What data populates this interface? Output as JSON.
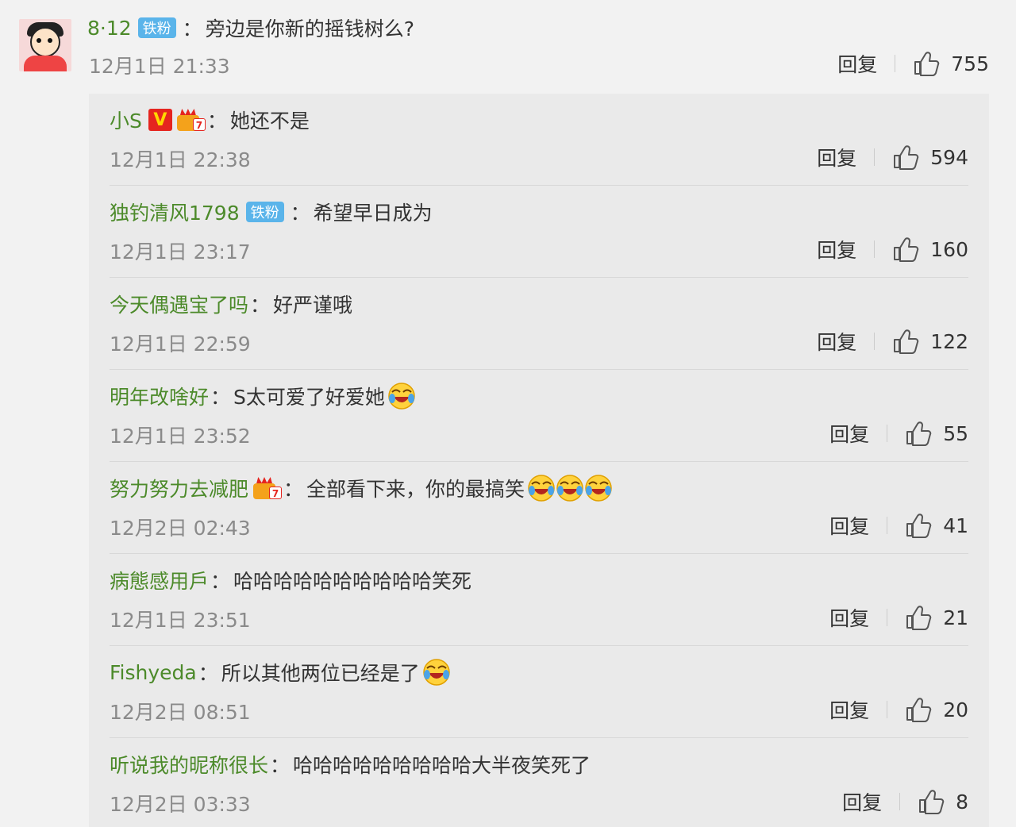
{
  "top_comment": {
    "username": "8·12",
    "badge": "铁粉",
    "colon": "：",
    "text": "旁边是你新的摇钱树么?",
    "time": "12月1日 21:33",
    "reply_label": "回复",
    "likes": "755"
  },
  "replies": [
    {
      "username": "小S",
      "badges": [
        "V",
        "crown"
      ],
      "colon": "：",
      "text": "她还不是",
      "emojis": 0,
      "time": "12月1日 22:38",
      "reply_label": "回复",
      "likes": "594"
    },
    {
      "username": "独钓清风1798",
      "badges": [
        "铁粉"
      ],
      "colon": "：",
      "text": "希望早日成为",
      "emojis": 0,
      "time": "12月1日 23:17",
      "reply_label": "回复",
      "likes": "160"
    },
    {
      "username": "今天偶遇宝了吗",
      "badges": [],
      "colon": "：",
      "text": "好严谨哦",
      "emojis": 0,
      "time": "12月1日 22:59",
      "reply_label": "回复",
      "likes": "122"
    },
    {
      "username": "明年改啥好",
      "badges": [],
      "colon": "：",
      "text": "S太可爱了好爱她",
      "emojis": 1,
      "time": "12月1日 23:52",
      "reply_label": "回复",
      "likes": "55"
    },
    {
      "username": "努力努力去减肥",
      "badges": [
        "crown"
      ],
      "colon": "：",
      "text": "全部看下来，你的最搞笑",
      "emojis": 3,
      "time": "12月2日 02:43",
      "reply_label": "回复",
      "likes": "41"
    },
    {
      "username": "病態感用戶",
      "badges": [],
      "colon": "：",
      "text": "哈哈哈哈哈哈哈哈哈哈笑死",
      "emojis": 0,
      "time": "12月1日 23:51",
      "reply_label": "回复",
      "likes": "21"
    },
    {
      "username": "Fishyeda",
      "badges": [],
      "colon": "：",
      "text": "所以其他两位已经是了",
      "emojis": 1,
      "time": "12月2日 08:51",
      "reply_label": "回复",
      "likes": "20"
    },
    {
      "username": "听说我的昵称很长",
      "badges": [],
      "colon": "：",
      "text": "哈哈哈哈哈哈哈哈哈大半夜笑死了",
      "emojis": 0,
      "time": "12月2日 03:33",
      "reply_label": "回复",
      "likes": "8"
    }
  ],
  "icons": {
    "like": "thumbs-up-icon",
    "emoji": "laugh-cry-emoji-icon",
    "crown": "crown-badge-icon",
    "avatar": "cartoon-avatar"
  },
  "colors": {
    "username": "#4c8a2a",
    "time": "#8a8a8a",
    "fan_badge": "#5ab4ea",
    "v_badge": "#e5251f"
  }
}
